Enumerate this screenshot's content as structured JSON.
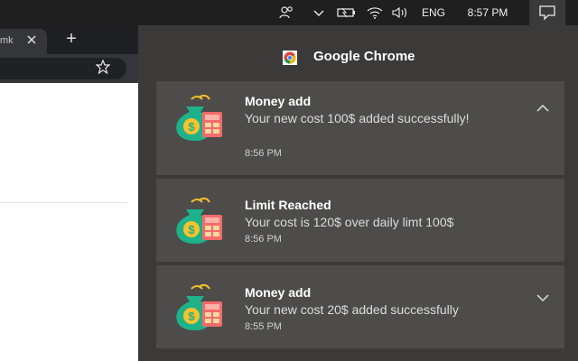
{
  "taskbar": {
    "language": "ENG",
    "time": "8:57 PM"
  },
  "browser": {
    "tab_title": "mk",
    "new_tab_label": "+"
  },
  "action_center": {
    "app_name": "Google Chrome",
    "notifications": [
      {
        "title": "Money add",
        "body": "Your new cost 100$ added successfully!",
        "time": "8:56 PM",
        "chevron": "chevron-up-icon"
      },
      {
        "title": "Limit Reached",
        "body": "Your cost is 120$ over daily limt 100$",
        "time": "8:56 PM"
      },
      {
        "title": "Money add",
        "body": "Your new cost 20$ added successfully",
        "time": "8:55 PM",
        "chevron": "chevron-down-icon"
      }
    ]
  },
  "colors": {
    "taskbar": "#1f1f1f",
    "action_center": "#3b3a39",
    "card": "#4d4c4a",
    "money_bag": "#1fb28a",
    "calculator": "#f26b6b",
    "coin": "#f7c22b"
  }
}
